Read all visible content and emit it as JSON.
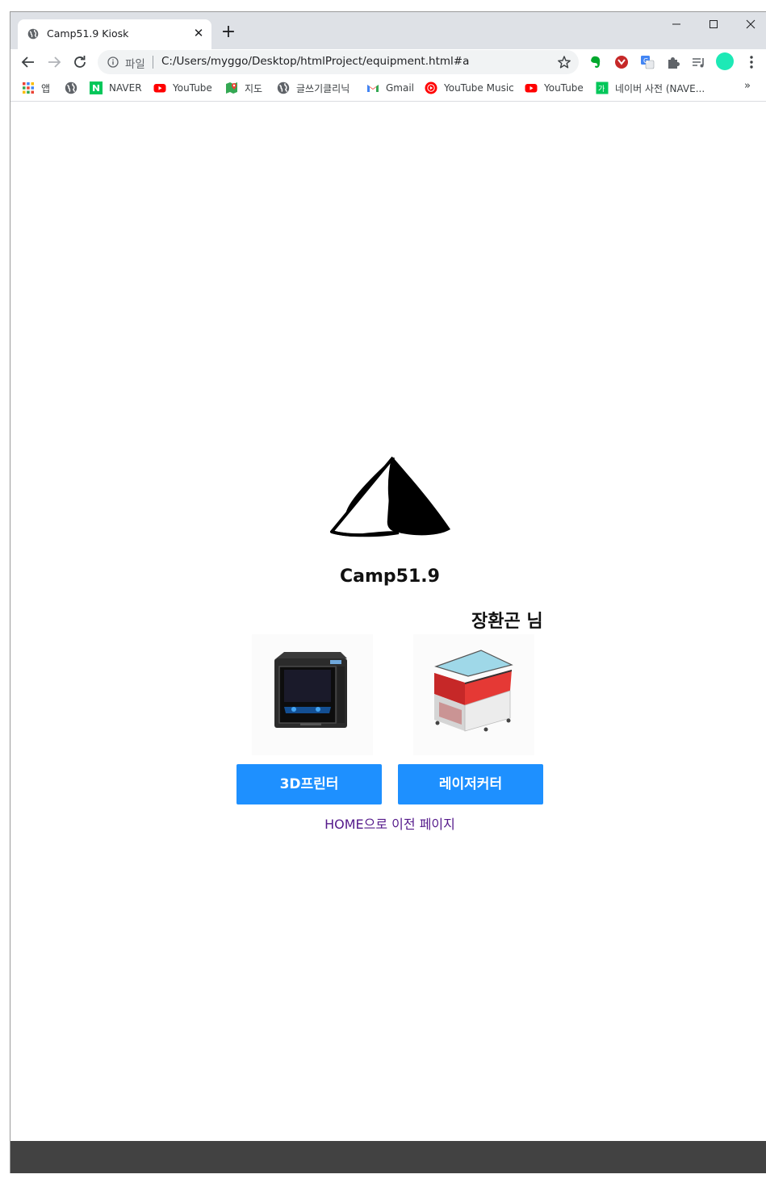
{
  "browser": {
    "tab": {
      "title": "Camp51.9 Kiosk",
      "close": "✕"
    },
    "new_tab": "+",
    "omnibox": {
      "scheme_label": "파일",
      "url": "C:/Users/myggo/Desktop/htmlProject/equipment.html#a"
    },
    "bookmarks": [
      {
        "label": "앱",
        "icon": "apps-grid-icon"
      },
      {
        "label": "",
        "icon": "globe-icon"
      },
      {
        "label": "NAVER",
        "icon": "naver-icon"
      },
      {
        "label": "YouTube",
        "icon": "youtube-icon"
      },
      {
        "label": "지도",
        "icon": "maps-icon"
      },
      {
        "label": "글쓰기클리닉",
        "icon": "globe-icon"
      },
      {
        "label": "Gmail",
        "icon": "gmail-icon"
      },
      {
        "label": "YouTube Music",
        "icon": "youtube-music-icon"
      },
      {
        "label": "YouTube",
        "icon": "youtube-icon"
      },
      {
        "label": "네이버 사전 (NAVE...",
        "icon": "naver-dictionary-icon"
      }
    ],
    "bookmarks_more": "»"
  },
  "page": {
    "brand_name": "Camp51.9",
    "user_greeting": "장환곤 님",
    "equipment": [
      {
        "image_icon": "3d-printer-image",
        "button_label": "3D프린터"
      },
      {
        "image_icon": "laser-cutter-image",
        "button_label": "레이저커터"
      }
    ],
    "home_link": "HOME으로 이전 페이지"
  },
  "colors": {
    "button_blue": "#1e90ff",
    "visited_link": "#551a8b",
    "footer": "#424242",
    "tabstrip": "#dee1e6"
  }
}
